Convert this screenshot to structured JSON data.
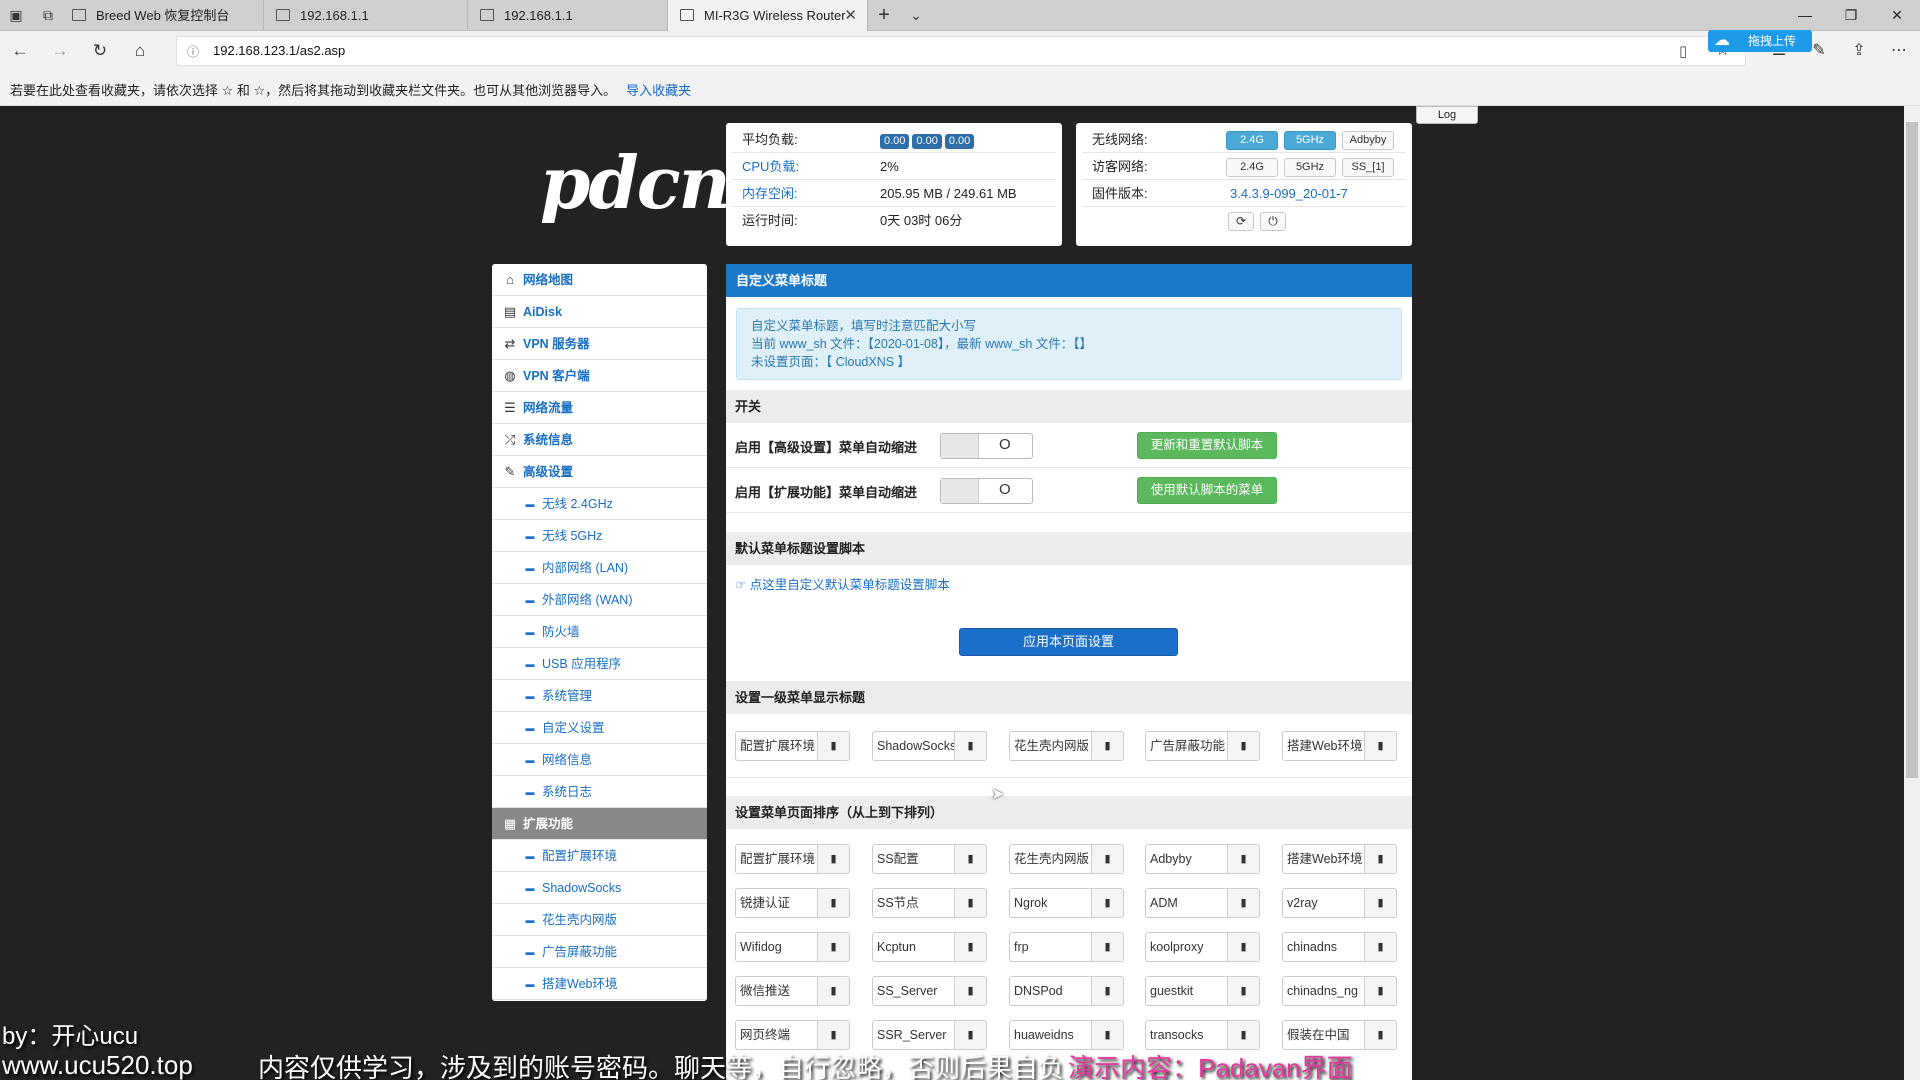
{
  "browser": {
    "tabs": [
      {
        "title": "Breed Web 恢复控制台"
      },
      {
        "title": "192.168.1.1"
      },
      {
        "title": "192.168.1.1"
      },
      {
        "title": "MI-R3G Wireless Router"
      }
    ],
    "url": "192.168.123.1/as2.asp",
    "upload_label": "拖拽上传",
    "fav_hint": "若要在此处查看收藏夹，请依次选择 ☆ 和 ☆，然后将其拖动到收藏夹栏文件夹。也可从其他浏览器导入。",
    "fav_import": "导入收藏夹"
  },
  "logo": "pdcn",
  "log_button": "Log",
  "status": {
    "load_label": "平均负载:",
    "load_values": [
      "0.00",
      "0.00",
      "0.00"
    ],
    "cpu_label": "CPU负载:",
    "cpu_value": "2%",
    "mem_label": "内存空闲:",
    "mem_value": "205.95 MB / 249.61 MB",
    "uptime_label": "运行时间:",
    "uptime_value": "0天 03时 06分",
    "wifi_label": "无线网络:",
    "wifi_buttons": [
      "2.4G",
      "5GHz",
      "Adbyby"
    ],
    "guest_label": "访客网络:",
    "guest_buttons": [
      "2.4G",
      "5GHz",
      "SS_[1]"
    ],
    "fw_label": "固件版本:",
    "fw_value": "3.4.3.9-099_20-01-7"
  },
  "sidebar": {
    "items": [
      {
        "label": "网络地图",
        "icon": "home-icon",
        "glyph": "⌂"
      },
      {
        "label": "AiDisk",
        "icon": "disk-icon",
        "glyph": "▤"
      },
      {
        "label": "VPN 服务器",
        "icon": "retweet-icon",
        "glyph": "⇄"
      },
      {
        "label": "VPN 客户端",
        "icon": "globe-icon",
        "glyph": "◍"
      },
      {
        "label": "网络流量",
        "icon": "list-icon",
        "glyph": "☰"
      },
      {
        "label": "系统信息",
        "icon": "random-icon",
        "glyph": "⤮"
      },
      {
        "label": "高级设置",
        "icon": "wrench-icon",
        "glyph": "✎"
      }
    ],
    "sub_advanced": [
      "无线 2.4GHz",
      "无线 5GHz",
      "内部网络 (LAN)",
      "外部网络 (WAN)",
      "防火墙",
      "USB 应用程序",
      "系统管理",
      "自定义设置",
      "网络信息",
      "系统日志"
    ],
    "ext_label": "扩展功能",
    "sub_ext": [
      "配置扩展环境",
      "ShadowSocks",
      "花生壳内网版",
      "广告屏蔽功能",
      "搭建Web环境"
    ]
  },
  "main": {
    "title": "自定义菜单标题",
    "info": [
      "自定义菜单标题，填写时注意匹配大小写",
      "当前 www_sh 文件：【2020-01-08】，最新 www_sh 文件：【】",
      "未设置页面：【 CloudXNS 】"
    ],
    "switch_section": "开关",
    "switch1_label": "启用【高级设置】菜单自动缩进",
    "switch1_btn": "更新和重置默认脚本",
    "switch2_label": "启用【扩展功能】菜单自动缩进",
    "switch2_btn": "使用默认脚本的菜单",
    "script_section": "默认菜单标题设置脚本",
    "script_link": "点这里自定义默认菜单标题设置脚本",
    "apply": "应用本页面设置",
    "level1_section": "设置一级菜单显示标题",
    "level1": [
      "配置扩展环境",
      "ShadowSocks",
      "花生壳内网版",
      "广告屏蔽功能",
      "搭建Web环境"
    ],
    "order_section": "设置菜单页面排序（从上到下排列）",
    "order_rows": [
      [
        "配置扩展环境",
        "SS配置",
        "花生壳内网版",
        "Adbyby",
        "搭建Web环境"
      ],
      [
        "锐捷认证",
        "SS节点",
        "Ngrok",
        "ADM",
        "v2ray"
      ],
      [
        "Wifidog",
        "Kcptun",
        "frp",
        "koolproxy",
        "chinadns"
      ],
      [
        "微信推送",
        "SS_Server",
        "DNSPod",
        "guestkit",
        "chinadns_ng"
      ],
      [
        "网页终端",
        "SSR_Server",
        "huaweidns",
        "transocks",
        "假装在中国"
      ]
    ]
  },
  "overlay": {
    "author": "by：开心ucu",
    "site": "www.ucu520.top",
    "notice": "内容仅供学习，涉及到的账号密码。聊天等，自行忽略，否则后果自负",
    "demo": "演示内容：Padavan界面"
  }
}
